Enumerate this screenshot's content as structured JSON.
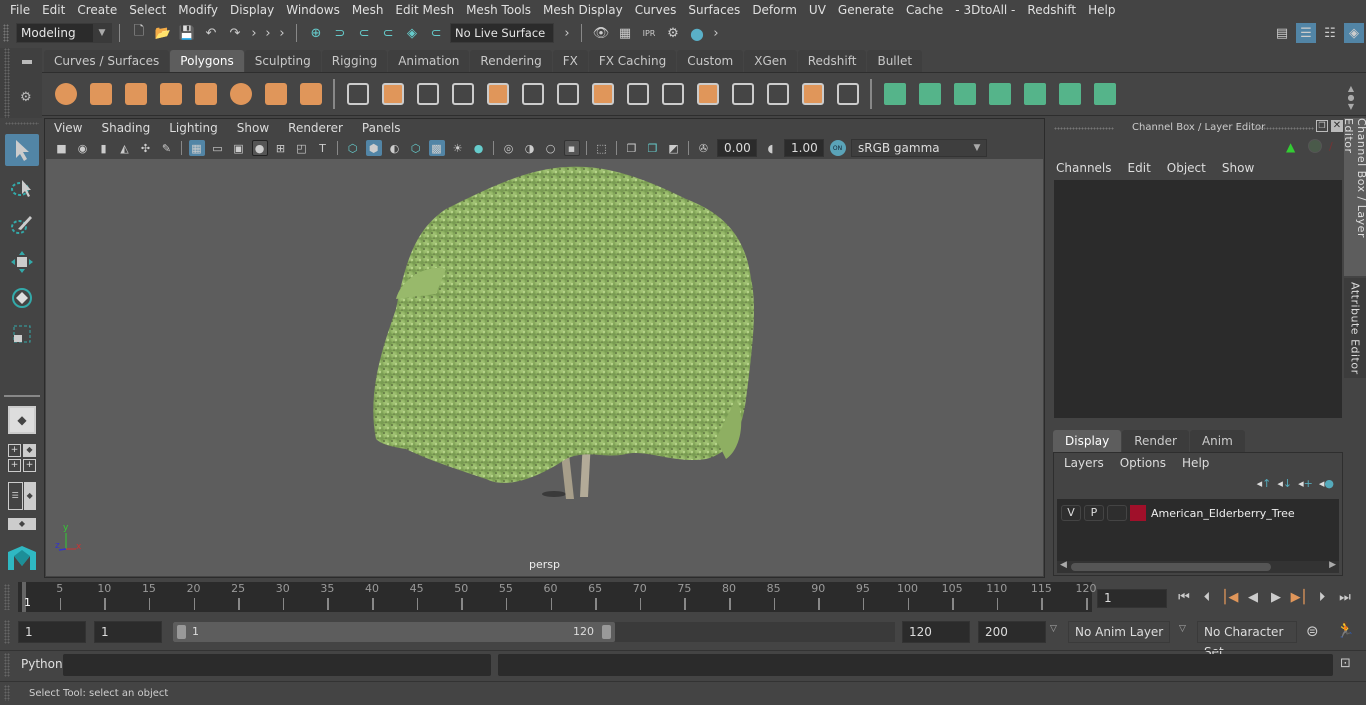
{
  "menubar": [
    "File",
    "Edit",
    "Create",
    "Select",
    "Modify",
    "Display",
    "Windows",
    "Mesh",
    "Edit Mesh",
    "Mesh Tools",
    "Mesh Display",
    "Curves",
    "Surfaces",
    "Deform",
    "UV",
    "Generate",
    "Cache",
    "- 3DtoAll -",
    "Redshift",
    "Help"
  ],
  "statusline": {
    "mode": "Modeling",
    "live_surface": "No Live Surface"
  },
  "shelf": {
    "tabs": [
      "Curves / Surfaces",
      "Polygons",
      "Sculpting",
      "Rigging",
      "Animation",
      "Rendering",
      "FX",
      "FX Caching",
      "Custom",
      "XGen",
      "Redshift",
      "Bullet"
    ],
    "active_tab": "Polygons",
    "icons": [
      "poly-sphere-icon",
      "poly-cube-icon",
      "poly-cylinder-icon",
      "poly-cone-icon",
      "poly-plane-icon",
      "poly-torus-icon",
      "poly-pyramid-icon",
      "poly-pipe-icon",
      "combine-icon",
      "separate-icon",
      "mirror-icon",
      "smooth-icon",
      "bevel-icon",
      "bridge-icon",
      "extrude-icon",
      "multi-cut-icon",
      "target-weld-icon",
      "append-polygon-icon",
      "fill-hole-icon",
      "insert-edge-loop-icon",
      "offset-edge-loop-icon",
      "merge-center-icon",
      "make-hole-icon",
      "planar-uv-icon",
      "cylindrical-uv-icon",
      "spherical-uv-icon",
      "automatic-uv-icon",
      "contour-uv-icon",
      "uv-editor-icon",
      "unfold-uv-icon"
    ]
  },
  "panel": {
    "menus": [
      "View",
      "Shading",
      "Lighting",
      "Show",
      "Renderer",
      "Panels"
    ],
    "exposure": "0.00",
    "gamma": "1.00",
    "color_space": "sRGB gamma",
    "camera_label": "persp",
    "axis": {
      "y": "y",
      "x": "x",
      "z": "z"
    }
  },
  "channel_box": {
    "title": "Channel Box / Layer Editor",
    "menus": [
      "Channels",
      "Edit",
      "Object",
      "Show"
    ]
  },
  "layer_editor": {
    "tabs": [
      "Display",
      "Render",
      "Anim"
    ],
    "active_tab": "Display",
    "menus": [
      "Layers",
      "Options",
      "Help"
    ],
    "layers": [
      {
        "v": "V",
        "p": "P",
        "color": "#a0102a",
        "name": "American_Elderberry_Tree"
      }
    ]
  },
  "side_tabs": [
    "Channel Box / Layer Editor",
    "Attribute Editor"
  ],
  "timeline": {
    "ticks": [
      5,
      10,
      15,
      20,
      25,
      30,
      35,
      40,
      45,
      50,
      55,
      60,
      65,
      70,
      75,
      80,
      85,
      90,
      95,
      100,
      105,
      110,
      115,
      120
    ],
    "start": 1,
    "end": 120,
    "current_frame_marker": "1",
    "current_frame": "1"
  },
  "range": {
    "start_field": "1",
    "playback_start": "1",
    "slider_start": "1",
    "slider_end": "120",
    "playback_end": "120",
    "end_field": "200",
    "anim_layer": "No Anim Layer",
    "character_set": "No Character Set"
  },
  "command_line": {
    "label": "Python",
    "value": ""
  },
  "help_line": "Select Tool: select an object"
}
